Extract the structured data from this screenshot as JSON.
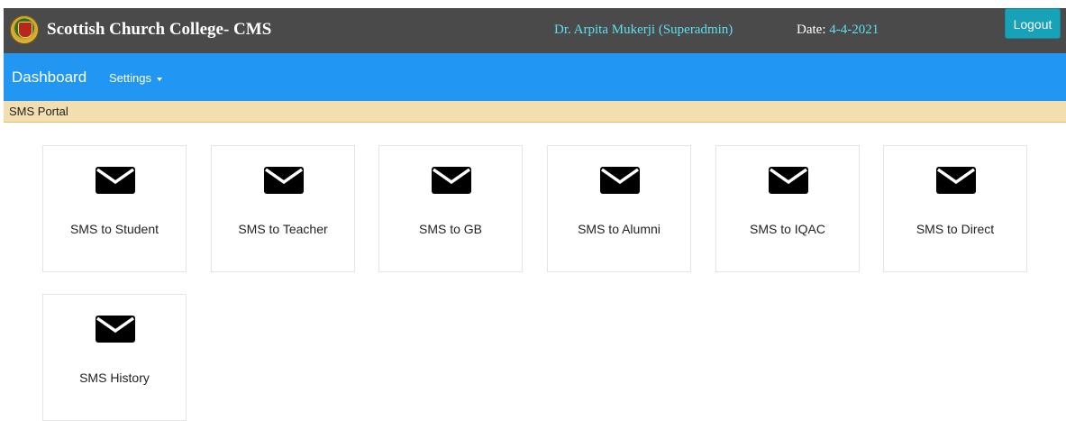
{
  "header": {
    "brand": "Scottish Church College- CMS",
    "user": "Dr. Arpita Mukerji (Superadmin)",
    "date_label": "Date:",
    "date_value": "4-4-2021",
    "logout_label": "Logout"
  },
  "navbar": {
    "dashboard_label": "Dashboard",
    "settings_label": "Settings"
  },
  "breadcrumb": {
    "label": "SMS Portal"
  },
  "cards": [
    {
      "label": "SMS to Student",
      "icon": "envelope-icon"
    },
    {
      "label": "SMS to Teacher",
      "icon": "envelope-icon"
    },
    {
      "label": "SMS to GB",
      "icon": "envelope-icon"
    },
    {
      "label": "SMS to Alumni",
      "icon": "envelope-icon"
    },
    {
      "label": "SMS to IQAC",
      "icon": "envelope-icon"
    },
    {
      "label": "SMS to Direct",
      "icon": "envelope-icon"
    },
    {
      "label": "SMS History",
      "icon": "envelope-icon"
    }
  ],
  "colors": {
    "header_bg": "#4a4a4a",
    "navbar_bg": "#2196f3",
    "breadcrumb_bg": "#f3deaf",
    "logout_bg": "#17a2b8",
    "accent_text": "#5ce0f0"
  }
}
